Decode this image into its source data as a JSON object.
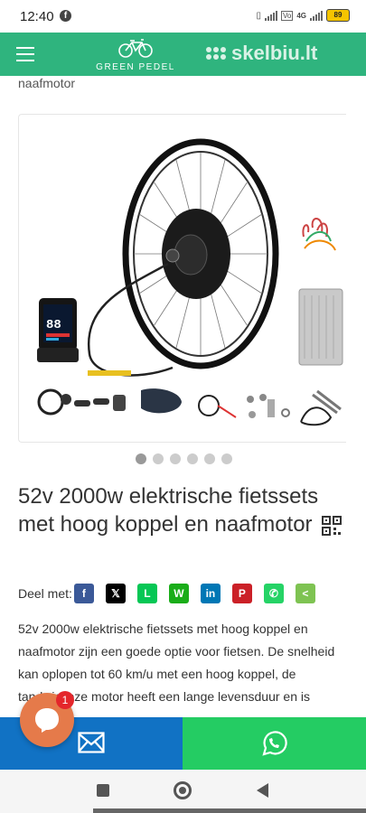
{
  "status_bar": {
    "time": "12:40",
    "network": "4G",
    "battery": "89",
    "icons": [
      "facebook-icon",
      "vibrate-icon",
      "signal-icon",
      "volte-icon",
      "battery-icon"
    ]
  },
  "header": {
    "brand": "GREEN PEDEL",
    "watermark": "skelbiu.lt",
    "colors": {
      "header": "#2fb47e",
      "mail": "#1172c4",
      "whatsapp": "#24cc63",
      "chat": "#e57a4a",
      "badge": "#e4262b"
    }
  },
  "breadcrumb_tail": "naafmotor",
  "gallery": {
    "slides": 6,
    "active_slide": 1,
    "display_readout": "88"
  },
  "product": {
    "title": "52v 2000w elektrische fietssets met hoog koppel en naafmotor",
    "share_label": "Deel met:",
    "share_targets": [
      {
        "icon": "facebook-icon",
        "glyph": "f",
        "color": "#3b5998"
      },
      {
        "icon": "x-icon",
        "glyph": "𝕏",
        "color": "#000000"
      },
      {
        "icon": "line-icon",
        "glyph": "L",
        "color": "#06c755"
      },
      {
        "icon": "wechat-icon",
        "glyph": "W",
        "color": "#1aad19"
      },
      {
        "icon": "linkedin-icon",
        "glyph": "in",
        "color": "#0077b5"
      },
      {
        "icon": "pinterest-icon",
        "glyph": "P",
        "color": "#cb2027"
      },
      {
        "icon": "whatsapp-icon",
        "glyph": "✆",
        "color": "#25d366"
      },
      {
        "icon": "share-icon",
        "glyph": "<",
        "color": "#7ec352"
      }
    ],
    "description": "52v 2000w elektrische fietssets met hoog koppel en naafmotor zijn een goede optie voor fietsen. De snelheid kan oplopen tot 60 km/u met een hoog koppel, de tandwielloze motor heeft een lange levensduur en is duurzaam."
  },
  "chat": {
    "badge_count": "1"
  },
  "nav": {
    "icons": [
      "recents-icon",
      "home-icon",
      "back-icon"
    ]
  }
}
